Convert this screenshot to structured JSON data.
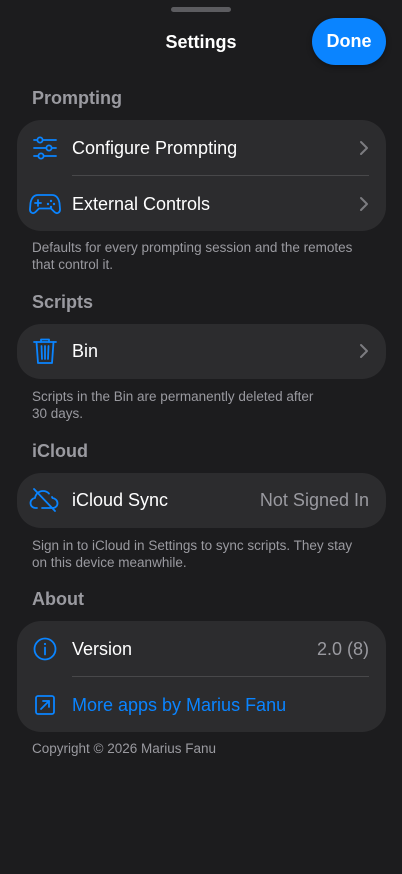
{
  "nav": {
    "title": "Settings",
    "done_label": "Done"
  },
  "colors": {
    "background": "#1c1c1e",
    "card": "#2c2c2e",
    "accent": "#0a84ff",
    "secondary_text": "#9a9aa0"
  },
  "sections": {
    "prompting": {
      "header": "Prompting",
      "items": [
        {
          "label": "Configure Prompting",
          "icon": "sliders-icon"
        },
        {
          "label": "External Controls",
          "icon": "gamecontroller-icon"
        }
      ],
      "footer_line1": "Defaults for every prompting session and the remotes",
      "footer_line2": "that control it."
    },
    "scripts": {
      "header": "Scripts",
      "items": [
        {
          "label": "Bin",
          "icon": "trash-icon"
        }
      ],
      "footer_line1": "Scripts in the Bin are permanently deleted after",
      "footer_line2": "30 days."
    },
    "icloud": {
      "header": "iCloud",
      "items": [
        {
          "label": "iCloud Sync",
          "value": "Not Signed In",
          "icon": "icloud-slash-icon"
        }
      ],
      "footer_line1": "Sign in to iCloud in Settings to sync scripts. They stay",
      "footer_line2": "on this device meanwhile."
    },
    "about": {
      "header": "About",
      "items": [
        {
          "label": "Version",
          "value": "2.0 (8)",
          "icon": "info-circle-icon"
        },
        {
          "label": "More apps by Marius Fanu",
          "icon": "external-link-icon"
        }
      ],
      "copyright": "Copyright © 2026 Marius Fanu"
    }
  }
}
